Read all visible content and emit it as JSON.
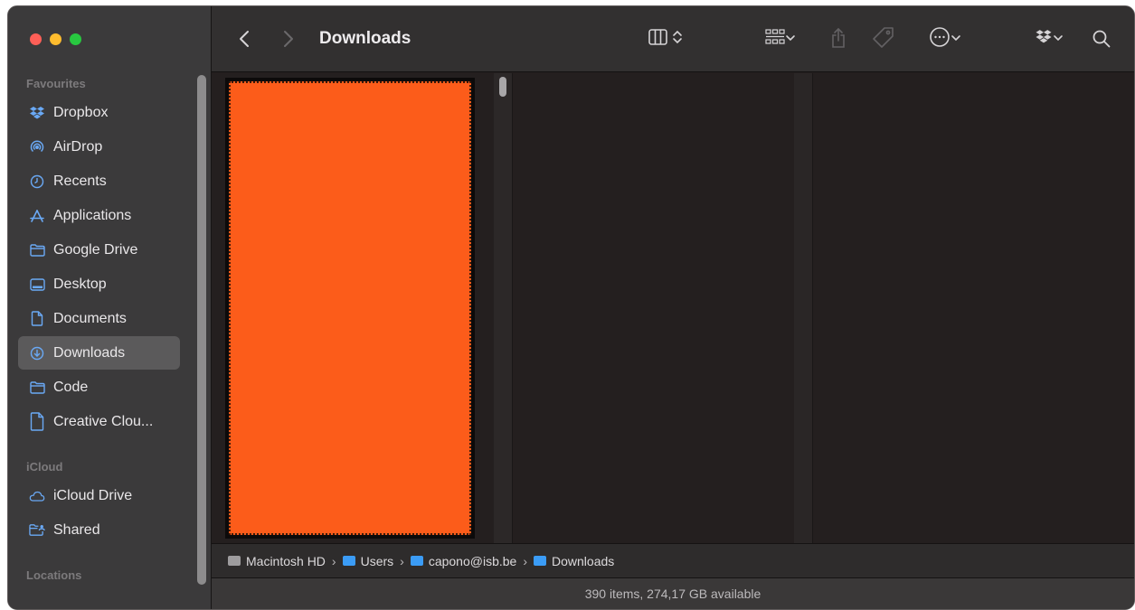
{
  "window": {
    "title": "Downloads"
  },
  "toolbar": {
    "title": "Downloads",
    "buttons": [
      "back-icon",
      "forward-icon",
      "column-view-icon",
      "group-icon",
      "share-icon",
      "tag-icon",
      "more-icon",
      "dropbox-icon",
      "search-icon"
    ]
  },
  "sidebar": {
    "favourites_header": "Favourites",
    "favourites": [
      {
        "label": "Dropbox",
        "icon": "dropbox-icon"
      },
      {
        "label": "AirDrop",
        "icon": "airdrop-icon"
      },
      {
        "label": "Recents",
        "icon": "clock-icon"
      },
      {
        "label": "Applications",
        "icon": "applications-icon"
      },
      {
        "label": "Google Drive",
        "icon": "folder-icon"
      },
      {
        "label": "Desktop",
        "icon": "desktop-icon"
      },
      {
        "label": "Documents",
        "icon": "document-icon"
      },
      {
        "label": "Downloads",
        "icon": "download-icon",
        "selected": true
      },
      {
        "label": "Code",
        "icon": "folder-icon"
      },
      {
        "label": "Creative Clou...",
        "icon": "document-icon"
      }
    ],
    "icloud_header": "iCloud",
    "icloud": [
      {
        "label": "iCloud Drive",
        "icon": "cloud-icon"
      },
      {
        "label": "Shared",
        "icon": "shared-folder-icon"
      }
    ],
    "locations_header": "Locations"
  },
  "pathbar": {
    "items": [
      "Macintosh HD",
      "Users",
      "capono@isb.be",
      "Downloads"
    ],
    "separator": "›"
  },
  "statusbar": {
    "text": "390 items, 274,17 GB available"
  },
  "colors": {
    "accent": "#3b9cf6",
    "preview": "#fc5c1a",
    "sidebar_bg": "#3b3a3b",
    "content_bg": "#241f1f"
  }
}
